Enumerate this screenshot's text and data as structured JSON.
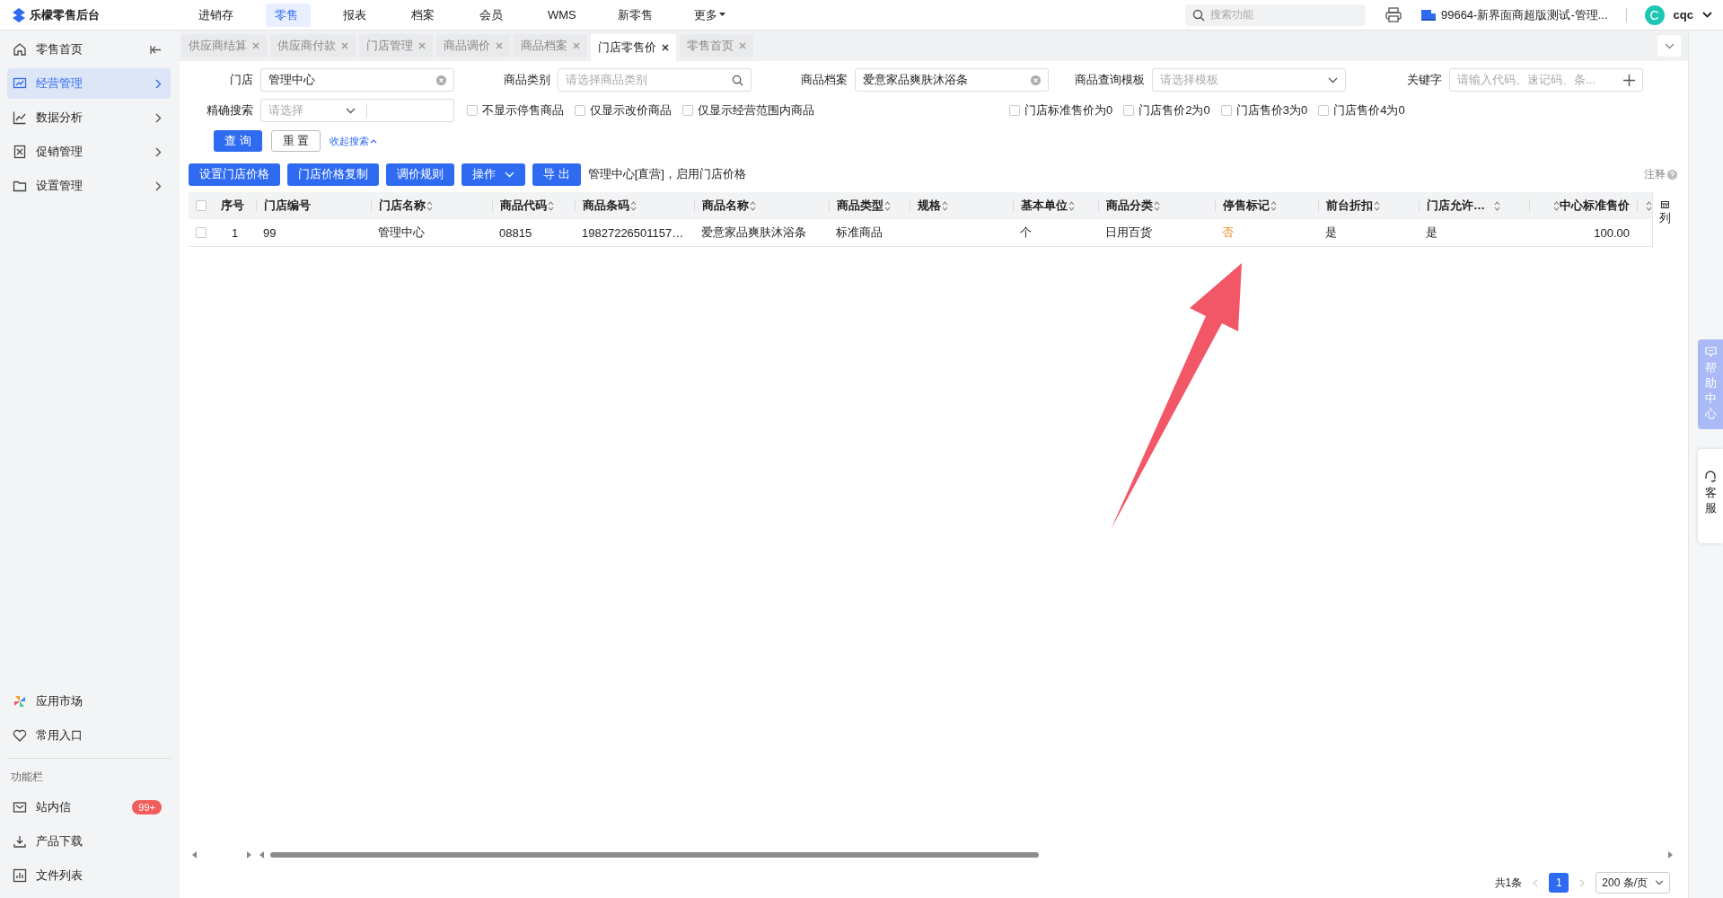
{
  "logo": {
    "title": "乐檬零售后台"
  },
  "top_nav": [
    {
      "label": "进销存",
      "selected": false
    },
    {
      "label": "零售",
      "selected": true
    },
    {
      "label": "报表",
      "selected": false
    },
    {
      "label": "档案",
      "selected": false
    },
    {
      "label": "会员",
      "selected": false
    },
    {
      "label": "WMS",
      "selected": false
    },
    {
      "label": "新零售",
      "selected": false
    },
    {
      "label": "更多",
      "selected": false
    }
  ],
  "search": {
    "placeholder": "搜索功能"
  },
  "account": {
    "store": "99664-新界面商超版测试-管理...",
    "avatar": "C",
    "user": "cqc"
  },
  "sidebar": {
    "items": [
      {
        "label": "零售首页",
        "selected": false
      },
      {
        "label": "经营管理",
        "selected": true
      },
      {
        "label": "数据分析",
        "selected": false
      },
      {
        "label": "促销管理",
        "selected": false
      },
      {
        "label": "设置管理",
        "selected": false
      }
    ],
    "shortcuts": [
      {
        "label": "应用市场"
      },
      {
        "label": "常用入口"
      }
    ],
    "section_title": "功能栏",
    "tools": [
      {
        "label": "站内信",
        "badge": "99+"
      },
      {
        "label": "产品下载"
      },
      {
        "label": "文件列表"
      }
    ]
  },
  "tabs": [
    {
      "label": "供应商结算",
      "selected": false
    },
    {
      "label": "供应商付款",
      "selected": false
    },
    {
      "label": "门店管理",
      "selected": false
    },
    {
      "label": "商品调价",
      "selected": false
    },
    {
      "label": "商品档案",
      "selected": false
    },
    {
      "label": "门店零售价",
      "selected": true
    },
    {
      "label": "零售首页",
      "selected": false
    }
  ],
  "filters": {
    "store": {
      "label": "门店",
      "value": "管理中心"
    },
    "category": {
      "label": "商品类别",
      "placeholder": "请选择商品类别"
    },
    "product": {
      "label": "商品档案",
      "value": "爱意家品爽肤沐浴条"
    },
    "template": {
      "label": "商品查询模板",
      "placeholder": "请选择模板"
    },
    "keyword": {
      "label": "关键字",
      "placeholder": "请输入代码、速记码、条..."
    },
    "exact": {
      "label": "精确搜索",
      "placeholder": "请选择"
    }
  },
  "options": [
    {
      "label": "不显示停售商品",
      "checked": false
    },
    {
      "label": "仅显示改价商品",
      "checked": false
    },
    {
      "label": "仅显示经营范围内商品",
      "checked": false
    },
    {
      "label": "门店标准售价为0",
      "checked": false
    },
    {
      "label": "门店售价2为0",
      "checked": false
    },
    {
      "label": "门店售价3为0",
      "checked": false
    },
    {
      "label": "门店售价4为0",
      "checked": false
    }
  ],
  "search_buttons": {
    "query": "查 询",
    "reset": "重 置",
    "collapse": "收起搜索"
  },
  "actions": [
    {
      "label": "设置门店价格",
      "kind": "button"
    },
    {
      "label": "门店价格复制",
      "kind": "button"
    },
    {
      "label": "调价规则",
      "kind": "button"
    },
    {
      "label": "操作",
      "kind": "dropdown"
    },
    {
      "label": "导 出",
      "kind": "button"
    }
  ],
  "status_text": "管理中心[直营]，启用门店价格",
  "note": "注释",
  "table": {
    "header_checked": false,
    "columns": [
      {
        "label": "序号",
        "sortable": false
      },
      {
        "label": "门店编号",
        "sortable": false
      },
      {
        "label": "门店名称",
        "sortable": true
      },
      {
        "label": "商品代码",
        "sortable": true
      },
      {
        "label": "商品条码",
        "sortable": true
      },
      {
        "label": "商品名称",
        "sortable": true
      },
      {
        "label": "商品类型",
        "sortable": true
      },
      {
        "label": "规格",
        "sortable": true
      },
      {
        "label": "基本单位",
        "sortable": true
      },
      {
        "label": "商品分类",
        "sortable": true
      },
      {
        "label": "停售标记",
        "sortable": true
      },
      {
        "label": "前台折扣",
        "sortable": true
      },
      {
        "label": "门店允许…",
        "sortable": true
      },
      {
        "label": "中心标准售价",
        "sortable": true
      },
      {
        "sortable": true
      }
    ],
    "column_settings": "列",
    "rows": [
      {
        "selected": false,
        "cells": [
          "1",
          "99",
          "管理中心",
          "08815",
          "19827226501157…",
          "爱意家品爽肤沐浴条",
          "标准商品",
          null,
          "个",
          "日用百货",
          "否",
          "是",
          "是",
          "100.00",
          null
        ]
      }
    ]
  },
  "pagination": {
    "total": "共1条",
    "pages": [
      {
        "label": "1",
        "selected": true
      }
    ],
    "page_size": "200 条/页"
  },
  "side_widgets": {
    "help": "帮助中心",
    "service": "客服"
  }
}
